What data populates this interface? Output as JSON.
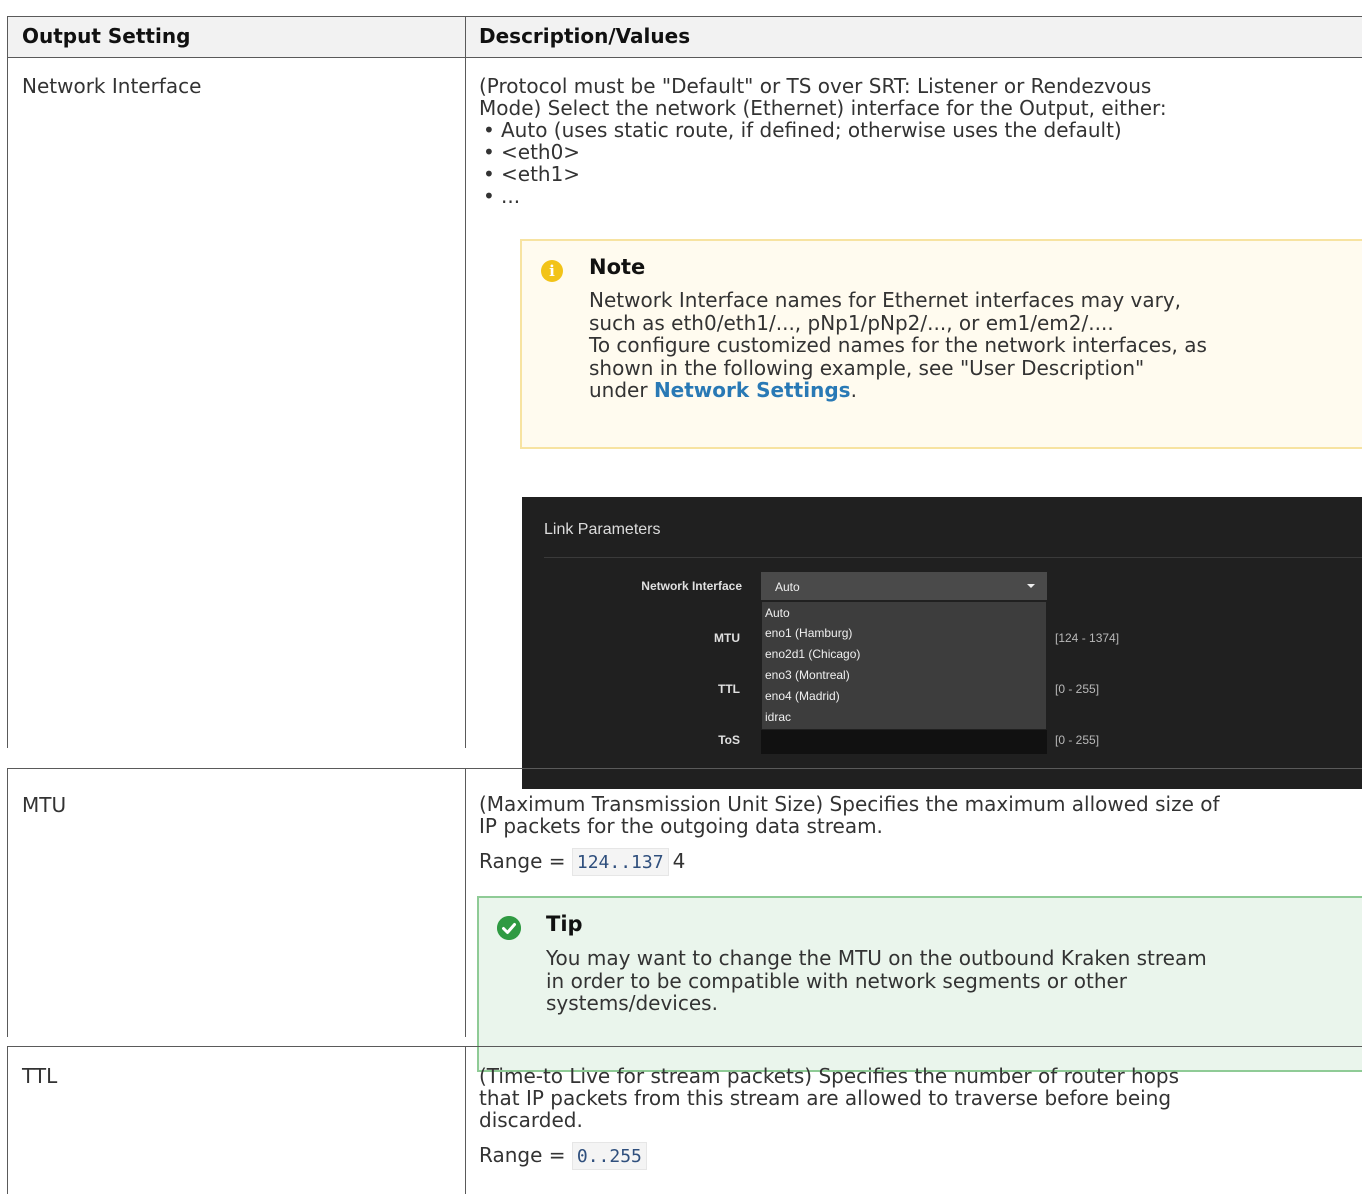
{
  "table": {
    "headers": {
      "setting": "Output Setting",
      "description": "Description/Values"
    },
    "network": {
      "setting": "Network Interface",
      "desc_lines": [
        "(Protocol must be \"Default\" or TS over SRT: Listener or Rendezvous",
        "Mode) Select the network (Ethernet) interface for the Output, either:"
      ],
      "bullets": [
        "Auto (uses static route, if defined; otherwise uses the default)",
        "<eth0>",
        "<eth1>",
        "..."
      ],
      "note": {
        "icon": "info-icon",
        "title": "Note",
        "lines": [
          "Network Interface names for Ethernet interfaces may vary,",
          "such as eth0/eth1/..., pNp1/pNp2/..., or em1/em2/....",
          "To configure customized names for the network interfaces, as",
          "shown in the following example, see \"User Description\""
        ],
        "last_prefix": "under ",
        "link": "Network Settings",
        "last_suffix": "."
      },
      "screenshot": {
        "title": "Link Parameters",
        "labels": {
          "network_interface": "Network Interface",
          "mtu": "MTU",
          "ttl": "TTL",
          "tos": "ToS"
        },
        "select_value": "Auto",
        "options": [
          "Auto",
          "eno1 (Hamburg)",
          "eno2d1 (Chicago)",
          "eno3 (Montreal)",
          "eno4 (Madrid)",
          "idrac"
        ],
        "ranges": {
          "mtu": "[124 - 1374]",
          "ttl": "[0 - 255]",
          "tos": "[0 - 255]"
        }
      }
    },
    "mtu": {
      "setting": "MTU",
      "desc_lines": [
        "(Maximum Transmission Unit Size) Specifies the maximum allowed size of",
        "IP packets for the outgoing data stream."
      ],
      "range_label": "Range = ",
      "range_code": "124..137",
      "range_suffix": "4",
      "tip": {
        "icon": "check-icon",
        "title": "Tip",
        "lines": [
          "You may want to change the MTU on the outbound Kraken stream",
          "in order to be compatible with network segments or other",
          "systems/devices."
        ]
      }
    },
    "ttl": {
      "setting": "TTL",
      "desc_lines": [
        "(Time-to Live for stream packets) Specifies the number of router hops",
        "that IP packets from this stream are allowed to traverse before being",
        "discarded."
      ],
      "range_label": "Range = ",
      "range_code": "0..255"
    }
  },
  "colors": {
    "link": "#2979b5",
    "note_bg": "#fffbef",
    "note_border": "#f7e3a1",
    "tip_bg": "#eaf5ec",
    "tip_border": "#8fcb96",
    "code": "#2f4f7d"
  }
}
